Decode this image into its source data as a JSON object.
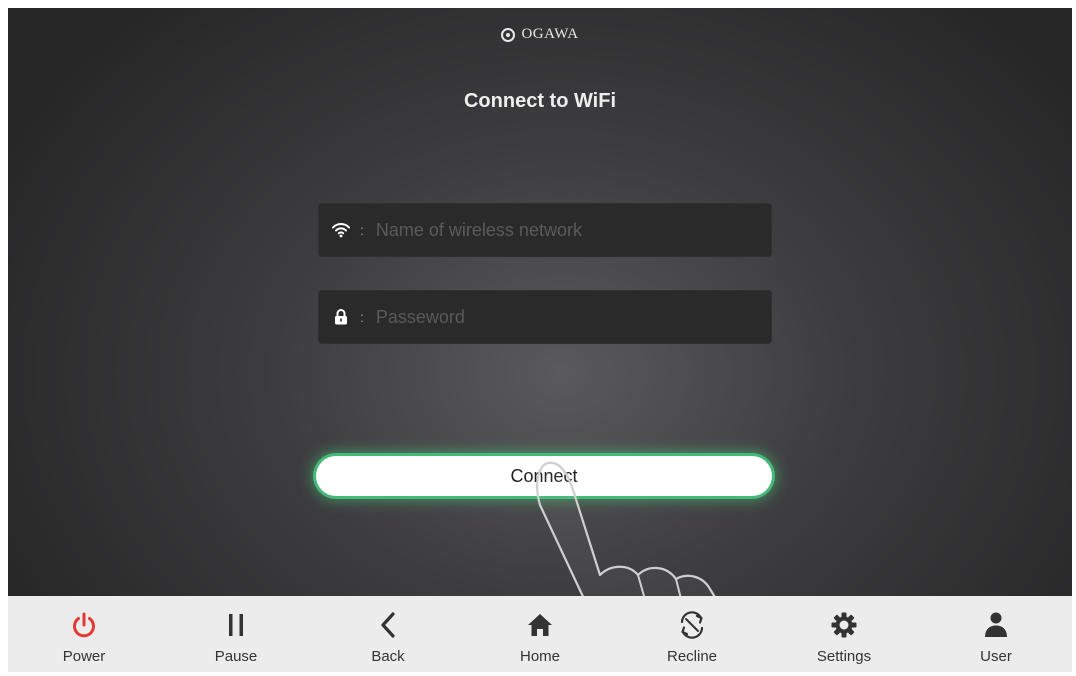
{
  "brand": {
    "logo_text": "OGAWA"
  },
  "screen": {
    "title": "Connect to WiFi"
  },
  "form": {
    "network": {
      "icon": "wifi-icon",
      "separator": ":",
      "placeholder": "Name of wireless network",
      "value": ""
    },
    "password": {
      "icon": "lock-icon",
      "separator": ":",
      "placeholder": "Passeword",
      "value": ""
    },
    "connect_label": "Connect"
  },
  "navbar": {
    "items": [
      {
        "label": "Power",
        "icon": "power-icon",
        "color": "#e53935"
      },
      {
        "label": "Pause",
        "icon": "pause-icon",
        "color": "#333333"
      },
      {
        "label": "Back",
        "icon": "chevron-left-icon",
        "color": "#333333"
      },
      {
        "label": "Home",
        "icon": "home-icon",
        "color": "#333333"
      },
      {
        "label": "Recline",
        "icon": "recline-icon",
        "color": "#333333"
      },
      {
        "label": "Settings",
        "icon": "gear-icon",
        "color": "#333333"
      },
      {
        "label": "User",
        "icon": "user-icon",
        "color": "#333333"
      }
    ]
  },
  "colors": {
    "accent_glow": "#46b878",
    "power": "#e53935"
  }
}
